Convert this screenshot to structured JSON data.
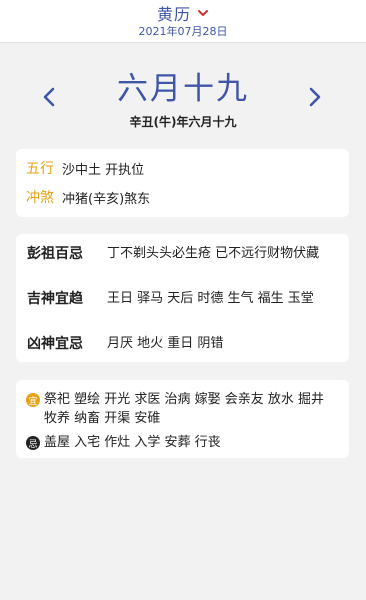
{
  "header": {
    "title": "黄历",
    "date": "2021年07月28日"
  },
  "lunar": {
    "big": "六月十九",
    "full": "辛丑(牛)年六月十九"
  },
  "info_card": {
    "wuxing_label": "五行",
    "wuxing_value": "沙中土 开执位",
    "chongsha_label": "冲煞",
    "chongsha_value": "冲猪(辛亥)煞东"
  },
  "gods_card": {
    "pengzu_label": "彭祖百忌",
    "pengzu_value": "丁不剃头头必生疮 已不远行财物伏藏",
    "jishen_label": "吉神宜趋",
    "jishen_value": "王日 驿马 天后 时德 生气 福生 玉堂",
    "xiongshen_label": "凶神宜忌",
    "xiongshen_value": "月厌 地火 重日 阴错"
  },
  "yiji_card": {
    "yi_icon_char": "宜",
    "yi_value": "祭祀 塑绘 开光 求医 治病 嫁娶 会亲友 放水 掘井 牧养 纳畜 开渠 安碓",
    "ji_icon_char": "忌",
    "ji_value": "盖屋 入宅 作灶 入学 安葬 行丧"
  },
  "colors": {
    "accent": "#3f56a8",
    "label_gold": "#e4a216",
    "yi_icon": "#e4a216",
    "ji_icon": "#222222"
  }
}
